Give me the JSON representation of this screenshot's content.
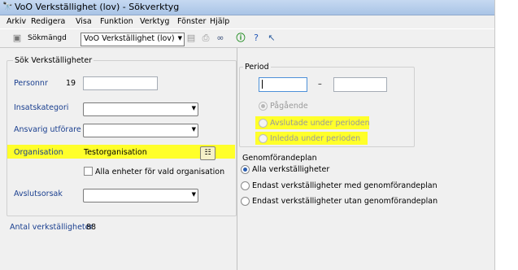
{
  "window": {
    "title": "VoO Verkställighet (lov) - Sökverktyg"
  },
  "menu": [
    "Arkiv",
    "Redigera",
    "Visa",
    "Funktion",
    "Verktyg",
    "Fönster",
    "Hjälp"
  ],
  "toolbar": {
    "search_set_label": "Sökmängd",
    "search_set_value": "VoO Verkställighet (lov)"
  },
  "search_panel": {
    "title": "Sök Verkställigheter",
    "personnr_label": "Personnr",
    "personnr_prefix": "19",
    "insatskategori_label": "Insatskategori",
    "ansvarig_label": "Ansvarig utförare",
    "organisation_label": "Organisation",
    "organisation_value": "Testorganisation",
    "all_units_label": "Alla enheter för vald organisation",
    "avslutsorsak_label": "Avslutsorsak"
  },
  "count": {
    "label": "Antal verkställigheter",
    "value": "88"
  },
  "period": {
    "title": "Period",
    "dash": "–",
    "options": [
      "Pågående",
      "Avslutade under perioden",
      "Inledda under perioden"
    ]
  },
  "plan": {
    "title": "Genomförandeplan",
    "options": [
      "Alla verkställigheter",
      "Endast verkställigheter med genomförandeplan",
      "Endast verkställigheter utan genomförandeplan"
    ]
  },
  "colors": {
    "highlight": "#ffff2a",
    "label_blue": "#1a3f8f"
  }
}
